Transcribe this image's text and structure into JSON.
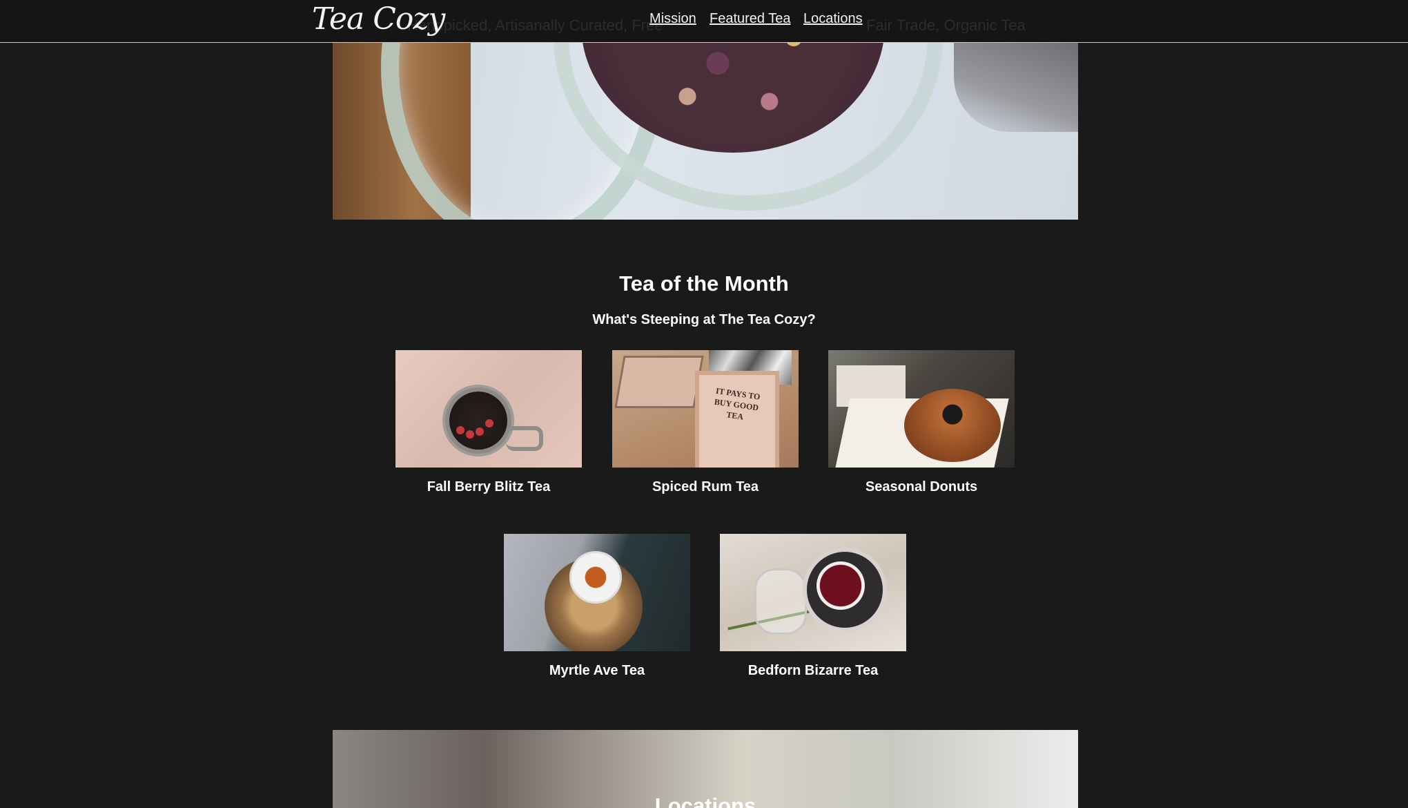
{
  "header": {
    "logo": "Tea Cozy",
    "nav": [
      {
        "label": "Mission"
      },
      {
        "label": "Featured Tea"
      },
      {
        "label": "Locations"
      }
    ],
    "ghost_text_left": "Handpicked, Artisanally Curated, Free",
    "ghost_text_right": "Fair Trade, Organic Tea"
  },
  "featured": {
    "title": "Tea of the Month",
    "subtitle": "What's Steeping at The Tea Cozy?",
    "items": [
      {
        "label": "Fall Berry Blitz Tea"
      },
      {
        "label": "Spiced Rum Tea"
      },
      {
        "label": "Seasonal Donuts"
      },
      {
        "label": "Myrtle Ave Tea"
      },
      {
        "label": "Bedforn Bizarre Tea"
      }
    ],
    "box_stamp": "IT PAYS TO BUY GOOD TEA"
  },
  "locations": {
    "title": "Locations"
  },
  "colors": {
    "background": "#1a1a1a",
    "topbar": "#151515",
    "text": "#ffffff"
  }
}
